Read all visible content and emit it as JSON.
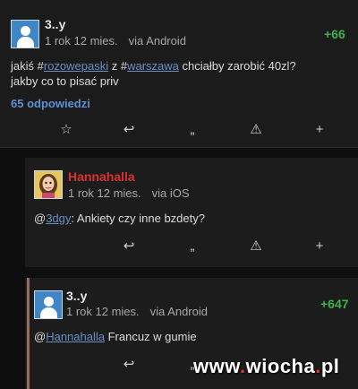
{
  "posts": [
    {
      "user": "3..y",
      "time": "1 rok 12 mies.",
      "via": "via Android",
      "score": "+66",
      "text_part1": "jakiś #",
      "tag1": "rozowepaski",
      "text_part2": " z #",
      "tag2": "warszawa",
      "text_part3": " chciałby zarobić 40zl?",
      "line2": "jakby co to pisać priv",
      "replies": "65 odpowiedzi"
    },
    {
      "user": "Hannahalla",
      "time": "1 rok 12 mies.",
      "via": "via iOS",
      "mention": "3dgy",
      "text": ": Ankiety czy inne bzdety?"
    },
    {
      "user": "3..y",
      "time": "1 rok 12 mies.",
      "via": "via Android",
      "score": "+647",
      "mention": "Hannahalla",
      "text": " Francuz w gumie"
    }
  ],
  "icons": {
    "favorite": "☆",
    "reply": "↩",
    "quote": "„",
    "report": "⚠",
    "plus": "+"
  },
  "watermark": {
    "part1": "www",
    "dot1": ".",
    "part2": "wiocha",
    "dot2": ".",
    "part3": "pl"
  }
}
